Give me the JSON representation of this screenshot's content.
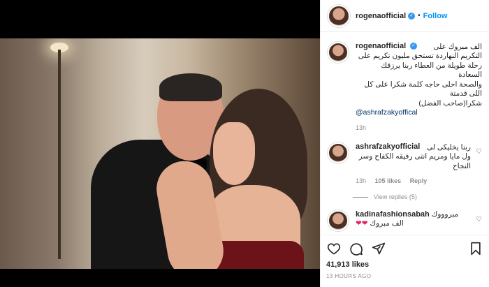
{
  "post": {
    "username": "rogenaofficial",
    "follow_label": "Follow",
    "dot": "•",
    "verified_mark": "✓"
  },
  "comments": [
    {
      "username": "rogenaofficial",
      "text_lines": [
        "الف مبروك على",
        "التكريم النهاردة تستحق مليون تكريم على",
        "رحلة طويلة من العطاء ربنا يرزقك السعادة",
        "والصحة احلى حاجه كلمة شكرا على كل",
        "اللى قدمتة",
        "شكرا(صاحب الفضل)"
      ],
      "mention": "@ashrafzakyoffical",
      "time": "13h"
    },
    {
      "username": "ashrafzakyofficial",
      "text_lines": [
        "ربنا يخليكى لى",
        "ول مايا ومريم انتى رفيقه الكفاح وسر",
        "النجاح"
      ],
      "time": "13h",
      "likes": "105 likes",
      "reply": "Reply",
      "view_replies": "View replies (5)"
    },
    {
      "username": "kadinafashionsabah",
      "text_lines": [
        "مبروووك",
        "الف مبروك"
      ],
      "hearts": "❤❤"
    }
  ],
  "footer": {
    "likes": "41,913 likes",
    "timestamp": "13 HOURS AGO"
  }
}
